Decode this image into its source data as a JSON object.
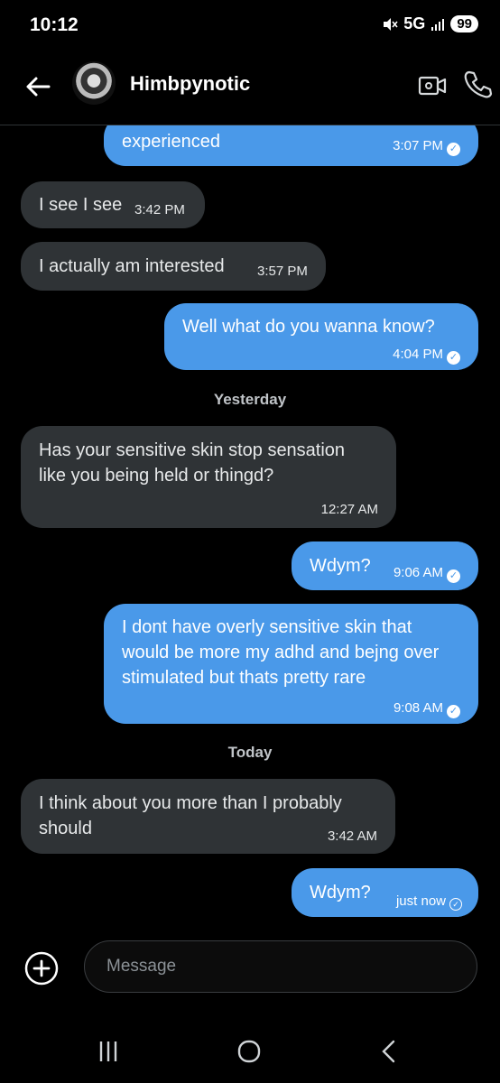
{
  "status_bar": {
    "time": "10:12",
    "network": "5G",
    "battery": "99"
  },
  "header": {
    "contact_name": "Himbpynotic"
  },
  "day_headers": {
    "yesterday": "Yesterday",
    "today": "Today"
  },
  "messages": [
    {
      "direction": "out",
      "text": "experienced",
      "time": "3:07 PM"
    },
    {
      "direction": "in",
      "text": "I see I see",
      "time": "3:42 PM"
    },
    {
      "direction": "in",
      "text": "I actually am interested",
      "time": "3:57 PM"
    },
    {
      "direction": "out",
      "text": "Well what do you wanna know?",
      "time": "4:04 PM"
    },
    {
      "direction": "in",
      "text": "Has your sensitive skin stop sensation like you being held or thingd?",
      "time": "12:27 AM"
    },
    {
      "direction": "out",
      "text": "Wdym?",
      "time": "9:06 AM"
    },
    {
      "direction": "out",
      "text": "I dont have overly sensitive skin that would be more my adhd and bejng over stimulated but thats pretty rare",
      "time": "9:08 AM"
    },
    {
      "direction": "in",
      "text": "I think about you more than I probably should",
      "time": "3:42 AM"
    },
    {
      "direction": "out",
      "text": "Wdym?",
      "time": "just now"
    }
  ],
  "composer": {
    "placeholder": "Message"
  },
  "colors": {
    "outgoing_bubble": "#4a99e9",
    "incoming_bubble": "#2f3336",
    "background": "#000000"
  },
  "icons": [
    "back-arrow-icon",
    "video-call-icon",
    "phone-icon",
    "add-circle-icon",
    "read-check-icon",
    "sent-check-icon",
    "recents-icon",
    "home-icon",
    "nav-back-icon"
  ]
}
